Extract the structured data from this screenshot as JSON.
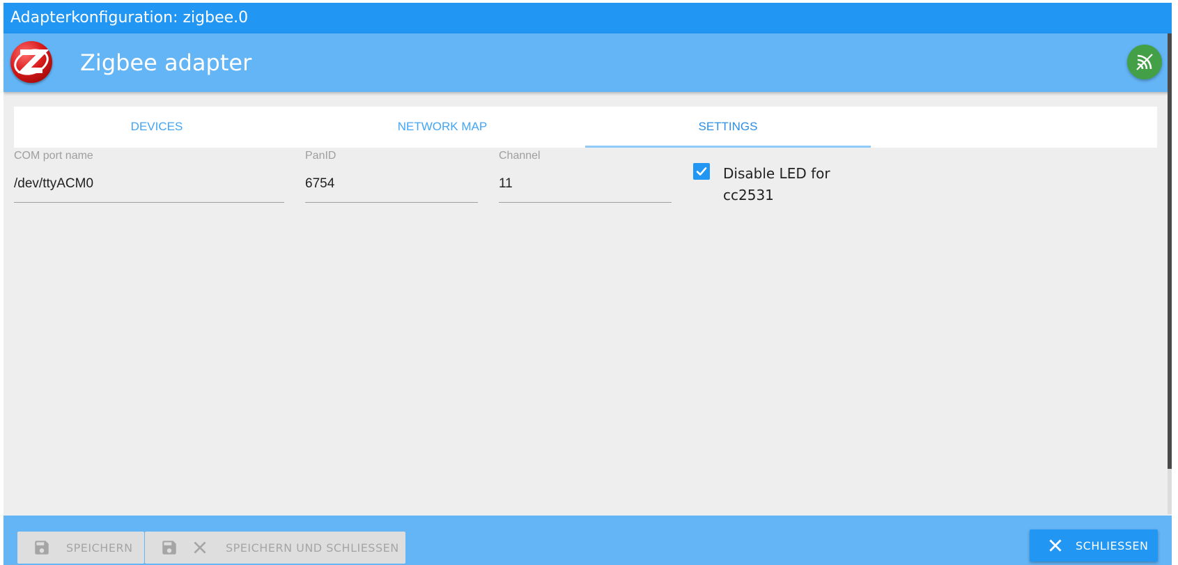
{
  "window": {
    "title": "Adapterkonfiguration: zigbee.0"
  },
  "header": {
    "title": "Zigbee adapter",
    "logo_icon": "zigbee-logo-icon",
    "status_icon": "connection-status-icon",
    "status_color": "#43a047"
  },
  "tabs": [
    {
      "label": "DEVICES",
      "active": false
    },
    {
      "label": "NETWORK MAP",
      "active": false
    },
    {
      "label": "SETTINGS",
      "active": true
    }
  ],
  "settings": {
    "com_port": {
      "label": "COM port name",
      "value": "/dev/ttyACM0"
    },
    "pan_id": {
      "label": "PanID",
      "value": "6754"
    },
    "channel": {
      "label": "Channel",
      "value": "11"
    },
    "disable_led": {
      "label": "Disable LED for cc2531",
      "checked": true
    }
  },
  "footer": {
    "save_label": "SPEICHERN",
    "save_close_label": "SPEICHERN UND SCHLIESSEN",
    "close_label": "SCHLIESSEN"
  },
  "colors": {
    "titlebar": "#2196f3",
    "header": "#64b5f6",
    "accent": "#2196f3"
  }
}
